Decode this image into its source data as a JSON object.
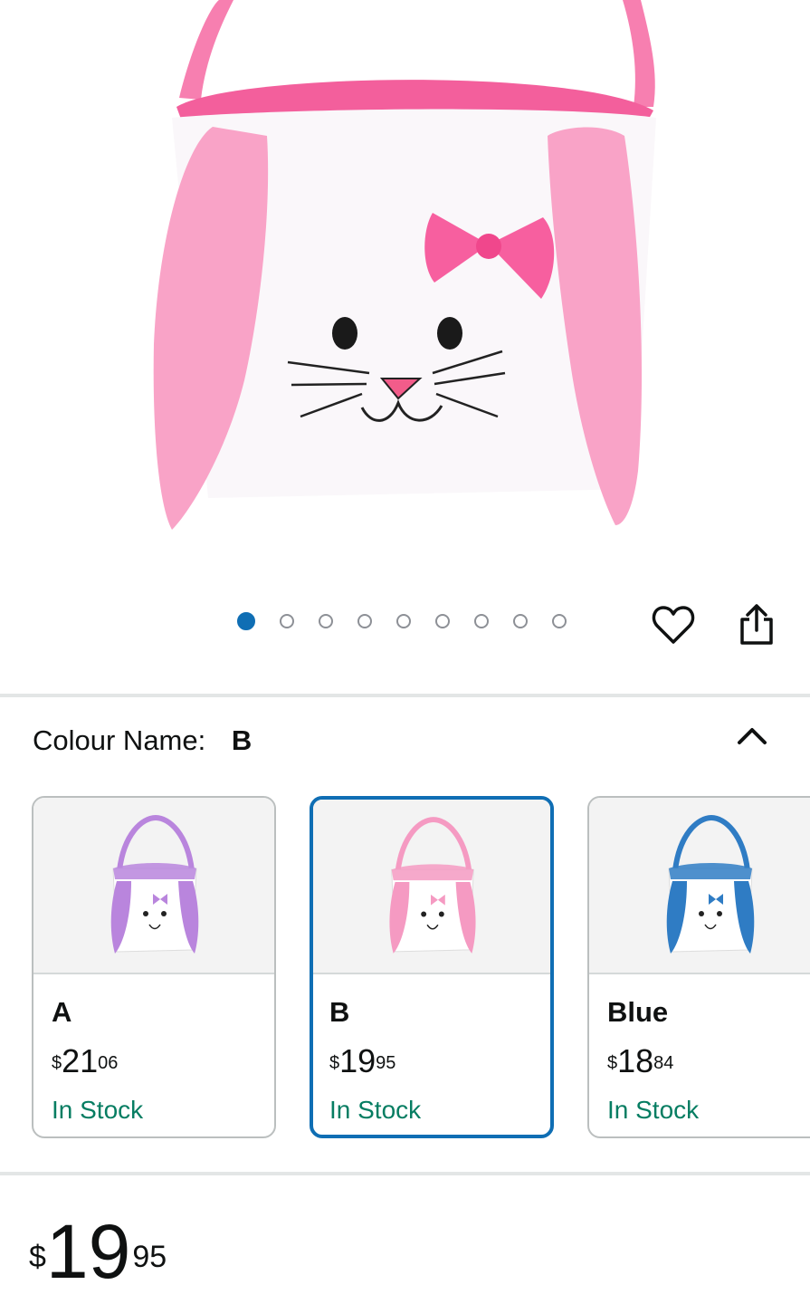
{
  "gallery": {
    "image_count": 9,
    "active_index": 0
  },
  "actions": {
    "wishlist_icon": "heart-icon",
    "share_icon": "share-icon"
  },
  "colour": {
    "label": "Colour Name:",
    "selected": "B",
    "collapse_icon": "chevron-up-icon"
  },
  "variants": [
    {
      "name": "A",
      "currency": "$",
      "whole": "21",
      "fraction": "06",
      "stock": "In Stock",
      "accent": "#b985dd"
    },
    {
      "name": "B",
      "currency": "$",
      "whole": "19",
      "fraction": "95",
      "stock": "In Stock",
      "accent": "#f59ac2"
    },
    {
      "name": "Blue",
      "currency": "$",
      "whole": "18",
      "fraction": "84",
      "stock": "In Stock",
      "accent": "#2f7cc4"
    }
  ],
  "price": {
    "currency": "$",
    "whole": "19",
    "fraction": "95"
  },
  "colors": {
    "accent": "#0f6eb4",
    "in_stock": "#067d62",
    "basket_pink": "#f58cb8"
  }
}
